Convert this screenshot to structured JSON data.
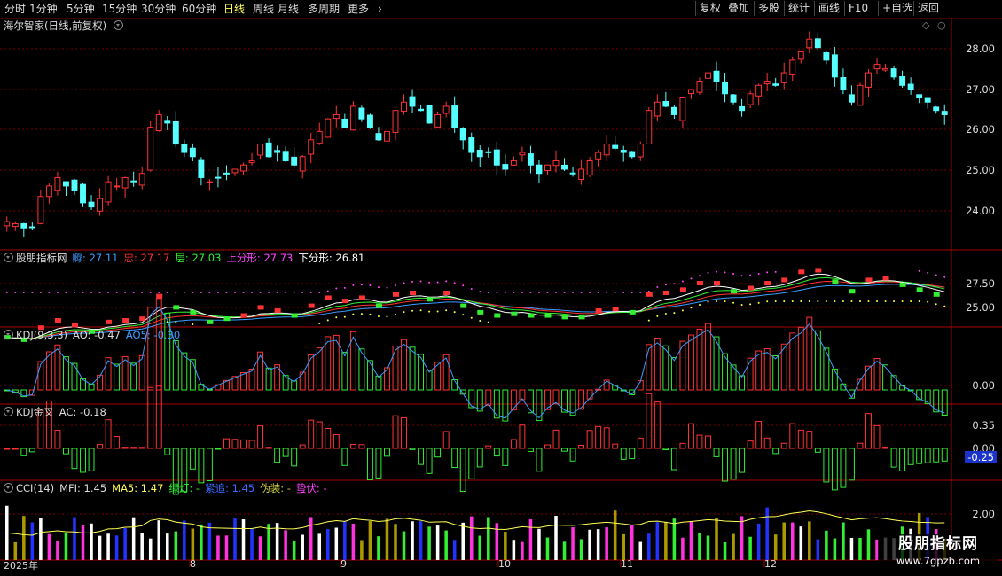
{
  "toolbar": {
    "periods": [
      "分时",
      "1分钟",
      "5分钟",
      "15分钟",
      "30分钟",
      "60分钟",
      "日线",
      "周线",
      "月线",
      "多周期",
      "更多"
    ],
    "active_period": "日线",
    "right_buttons": [
      "复权",
      "叠加",
      "多股",
      "统计",
      "画线",
      "F10",
      "+自选",
      "返回"
    ],
    "mark_label": "标记"
  },
  "price_pane": {
    "title": "海尔智家(日线,前复权)",
    "yticks": [
      "28.00",
      "27.00",
      "26.00",
      "25.00",
      "24.00"
    ]
  },
  "guppy_pane": {
    "name": "股朋指标网",
    "items": [
      {
        "label": "孵: ",
        "value": "27.11",
        "color": "#3b9cff"
      },
      {
        "label": "忠: ",
        "value": "27.17",
        "color": "#ff3333"
      },
      {
        "label": "层: ",
        "value": "27.03",
        "color": "#33ee33"
      },
      {
        "label": "上分形: ",
        "value": "27.73",
        "color": "#ff44ff"
      },
      {
        "label": "下分形: ",
        "value": "26.81",
        "color": "#ffffff"
      }
    ],
    "yticks": [
      "27.50",
      "25.00"
    ]
  },
  "kdj_pane": {
    "name": "KDJ(9,3,3)",
    "items": [
      {
        "label": "AO: ",
        "value": "-0.47",
        "color": "#dddddd"
      },
      {
        "label": "AO5: ",
        "value": "-0.30",
        "color": "#3b9cff"
      }
    ],
    "yticks": [
      "0.00"
    ]
  },
  "kdjx_pane": {
    "name": "KDJ金叉",
    "items": [
      {
        "label": "AC: ",
        "value": "-0.18",
        "color": "#dddddd"
      }
    ],
    "yticks": [
      "0.35",
      "0.00"
    ],
    "badge": "-0.25"
  },
  "cci_pane": {
    "name": "CCI(14)",
    "items": [
      {
        "label": "MFI: ",
        "value": "1.45",
        "color": "#dddddd"
      },
      {
        "label": "MA5: ",
        "value": "1.47",
        "color": "#ffff55"
      },
      {
        "label": "绿灯: ",
        "value": "-",
        "color": "#33ee33"
      },
      {
        "label": "紧追: ",
        "value": "1.45",
        "color": "#3b6cff"
      },
      {
        "label": "伪装: ",
        "value": "-",
        "color": "#cccc44"
      },
      {
        "label": "蛰伏: ",
        "value": "-",
        "color": "#ff44ff"
      }
    ],
    "yticks": [
      "2.00"
    ]
  },
  "xaxis": [
    "2025年",
    "8",
    "9",
    "10",
    "11",
    "12"
  ],
  "watermark": {
    "title": "股朋指标网",
    "url": "www.7gpzb.com"
  },
  "colors": {
    "up": "#ff3333",
    "down": "#55ffff",
    "grid": "#7a0000",
    "green": "#33ee33"
  },
  "chart_data": {
    "type": "candlestick",
    "title": "海尔智家(日线,前复权)",
    "ylim": [
      23.5,
      28.4
    ],
    "x_months": [
      "2025-07",
      "2025-08",
      "2025-09",
      "2025-10",
      "2025-11",
      "2025-12"
    ],
    "close": [
      23.75,
      23.7,
      23.6,
      23.62,
      24.35,
      24.6,
      24.8,
      24.6,
      24.5,
      24.2,
      24.1,
      24.3,
      24.7,
      24.6,
      24.8,
      24.7,
      24.9,
      26.0,
      26.3,
      26.1,
      25.6,
      25.4,
      25.3,
      24.8,
      24.7,
      24.8,
      24.9,
      25.0,
      25.1,
      25.2,
      25.6,
      25.3,
      25.4,
      25.2,
      25.1,
      25.3,
      25.7,
      25.9,
      26.2,
      26.3,
      26.0,
      26.5,
      26.2,
      26.0,
      25.7,
      25.9,
      26.4,
      26.6,
      26.5,
      26.4,
      26.1,
      26.3,
      26.5,
      26.0,
      25.7,
      25.4,
      25.3,
      25.4,
      25.1,
      25.0,
      25.2,
      25.4,
      25.1,
      24.9,
      25.1,
      25.2,
      25.0,
      24.9,
      25.0,
      25.2,
      25.4,
      25.6,
      25.5,
      25.4,
      25.3,
      25.6,
      26.4,
      26.6,
      26.5,
      26.3,
      26.7,
      26.9,
      27.1,
      27.3,
      27.1,
      26.8,
      26.6,
      26.4,
      26.8,
      27.0,
      27.1,
      27.0,
      27.3,
      27.6,
      27.8,
      28.1,
      27.9,
      27.6,
      27.2,
      26.9,
      26.6,
      27.0,
      27.3,
      27.5,
      27.4,
      27.2,
      27.0,
      26.9,
      26.7,
      26.6,
      26.4,
      26.3
    ],
    "indicators": {
      "孵": 27.11,
      "忠": 27.17,
      "层": 27.03,
      "上分形": 27.73,
      "下分形": 26.81,
      "AO": -0.47,
      "AO5": -0.3,
      "AC": -0.18,
      "MFI": 1.45,
      "MA5": 1.47,
      "紧追": 1.45
    }
  }
}
